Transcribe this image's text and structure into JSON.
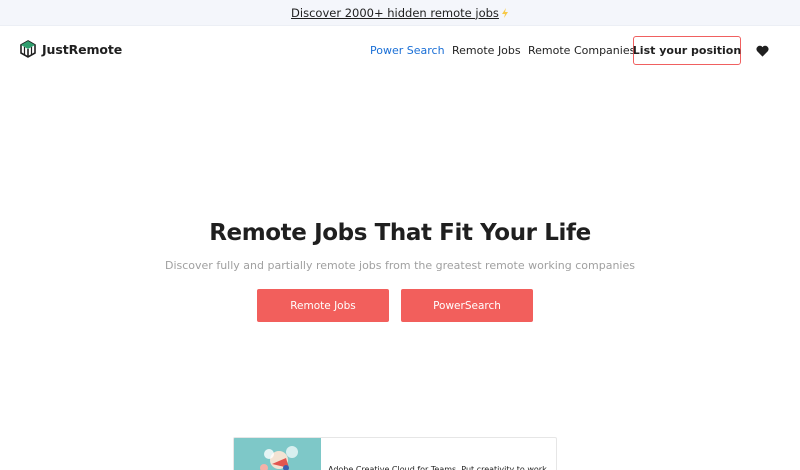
{
  "announcement": {
    "text": "Discover 2000+ hidden remote jobs",
    "icon": "lightning-icon"
  },
  "header": {
    "logo_text": "JustRemote",
    "nav": [
      {
        "label": "Power Search",
        "active": true
      },
      {
        "label": "Remote Jobs",
        "active": false
      },
      {
        "label": "Remote Companies",
        "active": false
      }
    ],
    "cta_label": "List your position",
    "favorites_icon": "heart-icon"
  },
  "hero": {
    "title": "Remote Jobs That Fit Your Life",
    "subtitle": "Discover fully and partially remote jobs from the greatest remote working companies",
    "buttons": [
      {
        "label": "Remote Jobs"
      },
      {
        "label": "PowerSearch"
      }
    ]
  },
  "ad": {
    "text": "Adobe Creative Cloud for Teams. Put creativity to work"
  },
  "colors": {
    "accent": "#f25f5c",
    "active_link": "#1a6fd6",
    "outline": "#f06060"
  }
}
